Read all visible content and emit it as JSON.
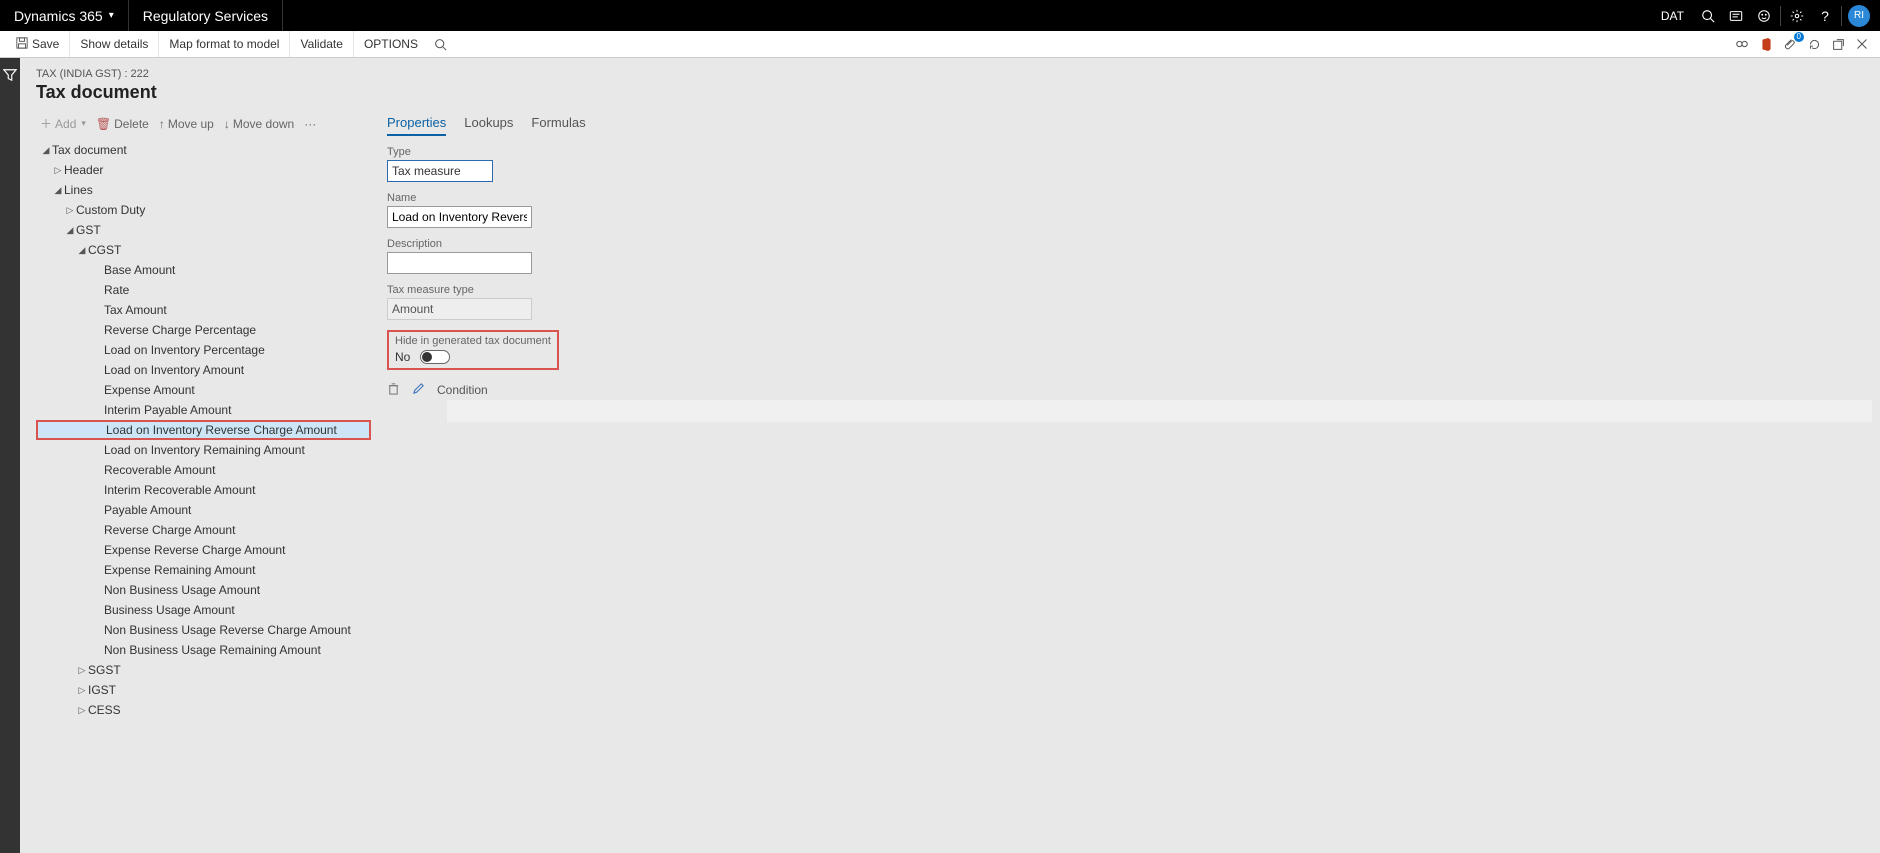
{
  "topbar": {
    "brand": "Dynamics 365",
    "section": "Regulatory Services",
    "company": "DAT",
    "avatar": "RI"
  },
  "cmdbar": {
    "save": "Save",
    "show_details": "Show details",
    "map_format": "Map format to model",
    "validate": "Validate",
    "options": "OPTIONS",
    "notif_count": "0"
  },
  "page": {
    "crumb": "TAX (INDIA GST) : 222",
    "title": "Tax document"
  },
  "tree_toolbar": {
    "add": "Add",
    "delete": "Delete",
    "move_up": "Move up",
    "move_down": "Move down"
  },
  "tree": {
    "tax_document": "Tax document",
    "header": "Header",
    "lines": "Lines",
    "custom_duty": "Custom Duty",
    "gst": "GST",
    "cgst": "CGST",
    "cgst_children": [
      "Base Amount",
      "Rate",
      "Tax Amount",
      "Reverse Charge Percentage",
      "Load on Inventory Percentage",
      "Load on Inventory Amount",
      "Expense Amount",
      "Interim Payable Amount",
      "Load on Inventory Reverse Charge Amount",
      "Load on Inventory Remaining Amount",
      "Recoverable Amount",
      "Interim Recoverable Amount",
      "Payable Amount",
      "Reverse Charge Amount",
      "Expense Reverse Charge Amount",
      "Expense Remaining Amount",
      "Non Business Usage Amount",
      "Business Usage Amount",
      "Non Business Usage Reverse Charge Amount",
      "Non Business Usage Remaining Amount"
    ],
    "sgst": "SGST",
    "igst": "IGST",
    "cess": "CESS"
  },
  "tabs": {
    "properties": "Properties",
    "lookups": "Lookups",
    "formulas": "Formulas"
  },
  "properties": {
    "type_label": "Type",
    "type_value": "Tax measure",
    "name_label": "Name",
    "name_value": "Load on Inventory Reverse Char...",
    "description_label": "Description",
    "description_value": "",
    "measure_type_label": "Tax measure type",
    "measure_type_value": "Amount",
    "hide_label": "Hide in generated tax document",
    "hide_value": "No",
    "condition_label": "Condition"
  }
}
